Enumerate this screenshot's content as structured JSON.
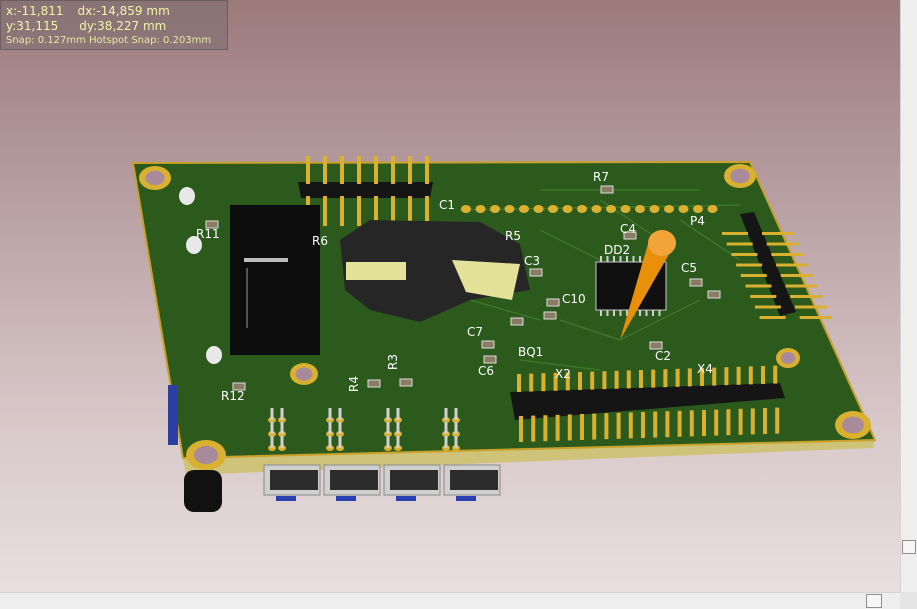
{
  "readout": {
    "x_label": "x:",
    "x_value": "-11,811",
    "dx_label": "dx:",
    "dx_value": "-14,859 mm",
    "y_label": "y:",
    "y_value": "31,115",
    "dy_label": "dy:",
    "dy_value": "38,227 mm",
    "snap_text": "Snap: 0.127mm Hotspot Snap: 0.203mm"
  },
  "designators": {
    "r7": "R7",
    "r11": "R11",
    "r12": "R12",
    "r5": "R5",
    "r6": "R6",
    "r4": "R4",
    "r3": "R3",
    "c1": "C1",
    "c2": "C2",
    "c3": "C3",
    "c4": "C4",
    "c5": "C5",
    "c6": "C6",
    "c7": "C7",
    "c10": "C10",
    "dd2": "DD2",
    "p4": "P4",
    "bq1": "BQ1",
    "x2": "X2",
    "x4": "X4"
  },
  "colors": {
    "background_top": "#9c7a7c",
    "background_bottom": "#e9dfe0",
    "board": "#2c5a1d",
    "board_edge": "#c9a02a",
    "pad": "#d9b030",
    "header": "#151515",
    "readout_text": "#f4f4a8"
  }
}
